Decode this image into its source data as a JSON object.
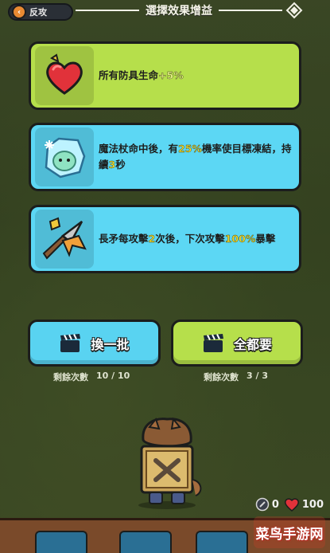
{
  "header": {
    "back_label": "反攻",
    "title": "選擇效果增益"
  },
  "buffs": [
    {
      "text_prefix": "所有防具生命",
      "highlight": "+5%",
      "text_suffix": "",
      "icon": "heart-icon",
      "color": "#b6df4b"
    },
    {
      "text_prefix": "魔法杖命中後，有",
      "highlight": "25%",
      "text_mid": "機率使目標凍結，持續",
      "highlight2": "3",
      "text_suffix": "秒",
      "icon": "frozen-slime-icon",
      "color": "#5cd7f4"
    },
    {
      "text_prefix": "長矛每攻擊",
      "highlight": "2",
      "text_mid": "次後，下次攻擊",
      "highlight2": "100%",
      "text_suffix": "暴擊",
      "icon": "spear-icon",
      "color": "#5cd7f4"
    }
  ],
  "actions": {
    "refresh_label": "換一批",
    "take_all_label": "全都要",
    "remaining_label_left": "剩餘次數",
    "remaining_value_left": "10 / 10",
    "remaining_label_right": "剩餘次數",
    "remaining_value_right": "3 / 3"
  },
  "stats": {
    "shield_value": "0",
    "health_value": "100"
  },
  "watermark": "菜鸟手游网"
}
